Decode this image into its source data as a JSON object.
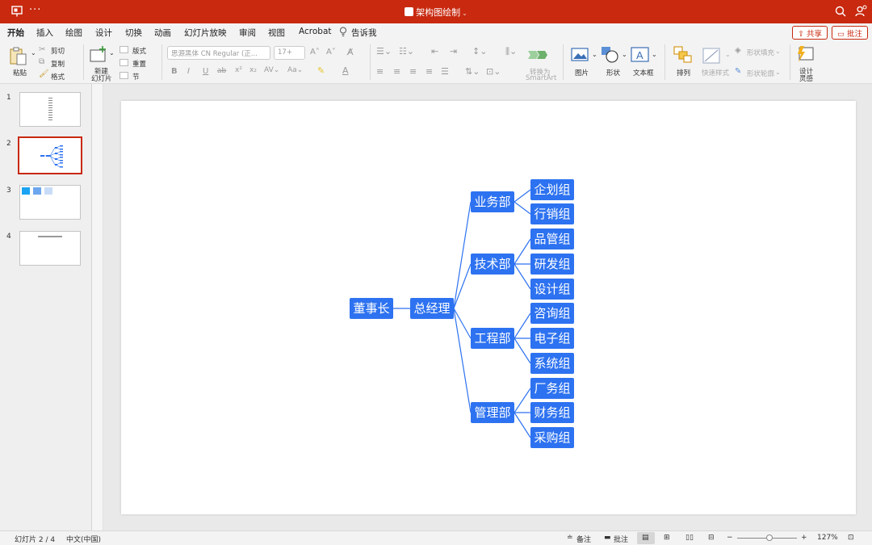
{
  "window": {
    "doc_title": "架构图绘制",
    "menu_dots": "···"
  },
  "colors": {
    "brand": "#c8290f",
    "node": "#2d72f0",
    "line": "#2d72f0"
  },
  "tabs": [
    "开始",
    "插入",
    "绘图",
    "设计",
    "切换",
    "动画",
    "幻灯片放映",
    "审阅",
    "视图",
    "Acrobat",
    "告诉我"
  ],
  "share": {
    "share_label": "共享",
    "comment_label": "批注"
  },
  "ribbon": {
    "paste": "粘贴",
    "cut": "剪切",
    "copy": "复制",
    "format": "格式",
    "new_slide_1": "新建",
    "new_slide_2": "幻灯片",
    "layout": "版式",
    "reset": "重置",
    "section": "节",
    "font_name": "思源黑体 CN Regular (正...",
    "font_size": "17+",
    "convert_1": "转换为",
    "convert_2": "SmartArt",
    "picture": "图片",
    "shape": "形状",
    "textbox": "文本框",
    "arrange": "排列",
    "quick_styles": "快速样式",
    "shape_fill": "形状填充",
    "shape_outline": "形状轮廓",
    "designer_1": "设计",
    "designer_2": "灵感"
  },
  "slides": {
    "numbers": [
      "1",
      "2",
      "3",
      "4"
    ],
    "selected": 2
  },
  "org_chart": {
    "root": "董事长",
    "manager": "总经理",
    "departments": [
      {
        "name": "业务部",
        "groups": [
          "企划组",
          "行销组"
        ]
      },
      {
        "name": "技术部",
        "groups": [
          "品管组",
          "研发组",
          "设计组"
        ]
      },
      {
        "name": "工程部",
        "groups": [
          "咨询组",
          "电子组",
          "系统组"
        ]
      },
      {
        "name": "管理部",
        "groups": [
          "厂务组",
          "财务组",
          "采购组"
        ]
      }
    ]
  },
  "status": {
    "slide_info": "幻灯片 2 / 4",
    "language": "中文(中国)",
    "notes": "备注",
    "comments": "批注",
    "zoom": "127%",
    "zoom_minus": "−",
    "zoom_plus": "+"
  }
}
